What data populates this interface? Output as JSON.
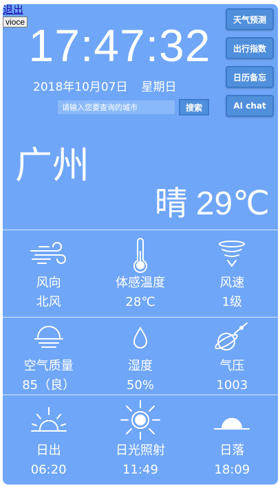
{
  "header": {
    "exit_label": "退出",
    "voice_label": "vioce"
  },
  "clock": {
    "time": "17:47:32",
    "date": "2018年10月07日",
    "weekday": "星期日"
  },
  "side_buttons": [
    "天气预测",
    "出行指数",
    "日历备忘",
    "AI chat"
  ],
  "search": {
    "placeholder": "请输入您要查询的城市",
    "button_label": "搜索"
  },
  "current": {
    "city": "广州",
    "condition": "晴",
    "temperature": "29℃"
  },
  "details": [
    {
      "icon": "wind-icon",
      "label": "风向",
      "value": "北风"
    },
    {
      "icon": "thermometer-icon",
      "label": "体感温度",
      "value": "28℃"
    },
    {
      "icon": "tornado-icon",
      "label": "风速",
      "value": "1级"
    },
    {
      "icon": "air-quality-icon",
      "label": "空气质量",
      "value": "85（良）"
    },
    {
      "icon": "humidity-drop-icon",
      "label": "湿度",
      "value": "50%"
    },
    {
      "icon": "pressure-icon",
      "label": "气压",
      "value": "1003"
    },
    {
      "icon": "sunrise-icon",
      "label": "日出",
      "value": "06:20"
    },
    {
      "icon": "sunshine-icon",
      "label": "日光照射",
      "value": "11:49"
    },
    {
      "icon": "sunset-icon",
      "label": "日落",
      "value": "18:09"
    }
  ],
  "colors": {
    "background": "#6fa6f7",
    "button": "#4f8fdb",
    "text": "#ffffff"
  }
}
